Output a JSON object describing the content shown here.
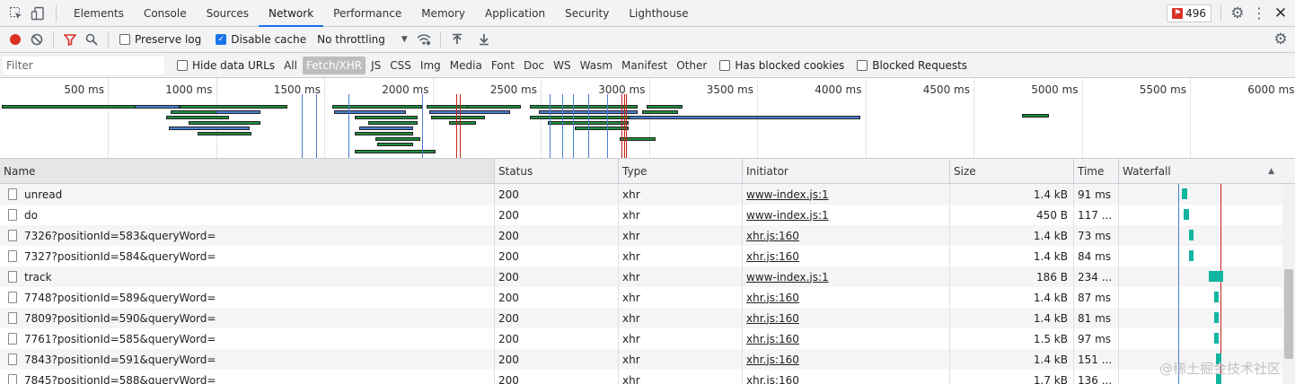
{
  "tabs": [
    "Elements",
    "Console",
    "Sources",
    "Network",
    "Performance",
    "Memory",
    "Application",
    "Security",
    "Lighthouse"
  ],
  "active_tab": "Network",
  "issues_count": "496",
  "toolbar": {
    "preserve_log": "Preserve log",
    "disable_cache": "Disable cache",
    "throttling": "No throttling"
  },
  "filterbar": {
    "placeholder": "Filter",
    "hide_data_urls": "Hide data URLs",
    "types": [
      "All",
      "Fetch/XHR",
      "JS",
      "CSS",
      "Img",
      "Media",
      "Font",
      "Doc",
      "WS",
      "Wasm",
      "Manifest",
      "Other"
    ],
    "active_type": "Fetch/XHR",
    "has_blocked_cookies": "Has blocked cookies",
    "blocked_requests": "Blocked Requests"
  },
  "overview_ticks": [
    "500 ms",
    "1000 ms",
    "1500 ms",
    "2000 ms",
    "2500 ms",
    "3000 ms",
    "3500 ms",
    "4000 ms",
    "4500 ms",
    "5000 ms",
    "5500 ms",
    "6000 ms"
  ],
  "columns": {
    "name": "Name",
    "status": "Status",
    "type": "Type",
    "initiator": "Initiator",
    "size": "Size",
    "time": "Time",
    "waterfall": "Waterfall"
  },
  "rows": [
    {
      "name": "unread",
      "status": "200",
      "type": "xhr",
      "initiator": "www-index.js:1",
      "size": "1.4 kB",
      "time": "91 ms"
    },
    {
      "name": "do",
      "status": "200",
      "type": "xhr",
      "initiator": "www-index.js:1",
      "size": "450 B",
      "time": "117 ..."
    },
    {
      "name": "7326?positionId=583&queryWord=",
      "status": "200",
      "type": "xhr",
      "initiator": "xhr.js:160",
      "size": "1.4 kB",
      "time": "73 ms"
    },
    {
      "name": "7327?positionId=584&queryWord=",
      "status": "200",
      "type": "xhr",
      "initiator": "xhr.js:160",
      "size": "1.4 kB",
      "time": "84 ms"
    },
    {
      "name": "track",
      "status": "200",
      "type": "xhr",
      "initiator": "www-index.js:1",
      "size": "186 B",
      "time": "234 ..."
    },
    {
      "name": "7748?positionId=589&queryWord=",
      "status": "200",
      "type": "xhr",
      "initiator": "xhr.js:160",
      "size": "1.4 kB",
      "time": "87 ms"
    },
    {
      "name": "7809?positionId=590&queryWord=",
      "status": "200",
      "type": "xhr",
      "initiator": "xhr.js:160",
      "size": "1.4 kB",
      "time": "81 ms"
    },
    {
      "name": "7761?positionId=585&queryWord=",
      "status": "200",
      "type": "xhr",
      "initiator": "xhr.js:160",
      "size": "1.5 kB",
      "time": "97 ms"
    },
    {
      "name": "7843?positionId=591&queryWord=",
      "status": "200",
      "type": "xhr",
      "initiator": "xhr.js:160",
      "size": "1.4 kB",
      "time": "151 ..."
    },
    {
      "name": "7845?positionId=588&queryWord=",
      "status": "200",
      "type": "xhr",
      "initiator": "xhr.js:160",
      "size": "1.7 kB",
      "time": "136 ..."
    }
  ],
  "watermark": "@稀土掘金技术社区",
  "colors": {
    "accent": "#1a73e8",
    "record": "#d93025",
    "filter_icon": "#d93025",
    "bar_green": "#1e8e3e",
    "bar_teal": "#12b5a0",
    "bar_blue": "#4a7fd4",
    "line_red": "#c5221f"
  }
}
